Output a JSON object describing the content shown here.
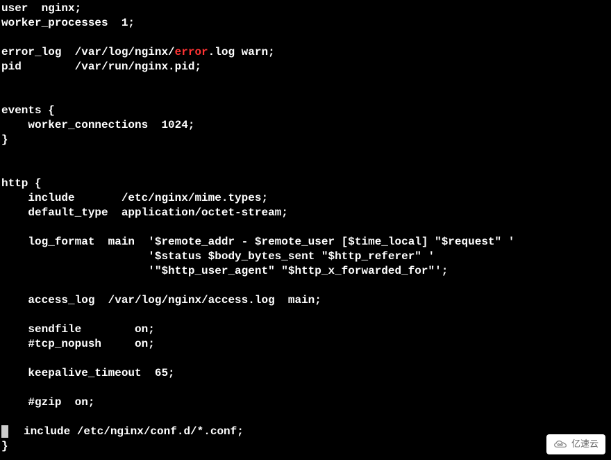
{
  "config": {
    "lines": [
      {
        "segments": [
          {
            "t": "user  nginx;"
          }
        ]
      },
      {
        "segments": [
          {
            "t": "worker_processes  1;"
          }
        ]
      },
      {
        "segments": [
          {
            "t": ""
          }
        ]
      },
      {
        "segments": [
          {
            "t": "error_log  /var/log/nginx/"
          },
          {
            "t": "error",
            "cls": "red"
          },
          {
            "t": ".log warn;"
          }
        ]
      },
      {
        "segments": [
          {
            "t": "pid        /var/run/nginx.pid;"
          }
        ]
      },
      {
        "segments": [
          {
            "t": ""
          }
        ]
      },
      {
        "segments": [
          {
            "t": ""
          }
        ]
      },
      {
        "segments": [
          {
            "t": "events {"
          }
        ]
      },
      {
        "segments": [
          {
            "t": "    worker_connections  1024;"
          }
        ]
      },
      {
        "segments": [
          {
            "t": "}"
          }
        ]
      },
      {
        "segments": [
          {
            "t": ""
          }
        ]
      },
      {
        "segments": [
          {
            "t": ""
          }
        ]
      },
      {
        "segments": [
          {
            "t": "http {"
          }
        ]
      },
      {
        "segments": [
          {
            "t": "    include       /etc/nginx/mime.types;"
          }
        ]
      },
      {
        "segments": [
          {
            "t": "    default_type  application/octet-stream;"
          }
        ]
      },
      {
        "segments": [
          {
            "t": ""
          }
        ]
      },
      {
        "segments": [
          {
            "t": "    log_format  main  '$remote_addr - $remote_user [$time_local] \"$request\" '"
          }
        ]
      },
      {
        "segments": [
          {
            "t": "                      '$status $body_bytes_sent \"$http_referer\" '"
          }
        ]
      },
      {
        "segments": [
          {
            "t": "                      '\"$http_user_agent\" \"$http_x_forwarded_for\"';"
          }
        ]
      },
      {
        "segments": [
          {
            "t": ""
          }
        ]
      },
      {
        "segments": [
          {
            "t": "    access_log  /var/log/nginx/access.log  main;"
          }
        ]
      },
      {
        "segments": [
          {
            "t": ""
          }
        ]
      },
      {
        "segments": [
          {
            "t": "    sendfile        on;"
          }
        ]
      },
      {
        "segments": [
          {
            "t": "    #tcp_nopush     on;"
          }
        ]
      },
      {
        "segments": [
          {
            "t": ""
          }
        ]
      },
      {
        "segments": [
          {
            "t": "    keepalive_timeout  65;"
          }
        ]
      },
      {
        "segments": [
          {
            "t": ""
          }
        ]
      },
      {
        "segments": [
          {
            "t": "    #gzip  on;"
          }
        ]
      },
      {
        "segments": [
          {
            "t": ""
          }
        ]
      },
      {
        "segments": [
          {
            "cursor": true
          },
          {
            "t": "include /etc/nginx/conf.d/*.conf;"
          }
        ]
      },
      {
        "segments": [
          {
            "t": "}"
          }
        ]
      }
    ]
  },
  "watermark": {
    "text": "亿速云"
  }
}
